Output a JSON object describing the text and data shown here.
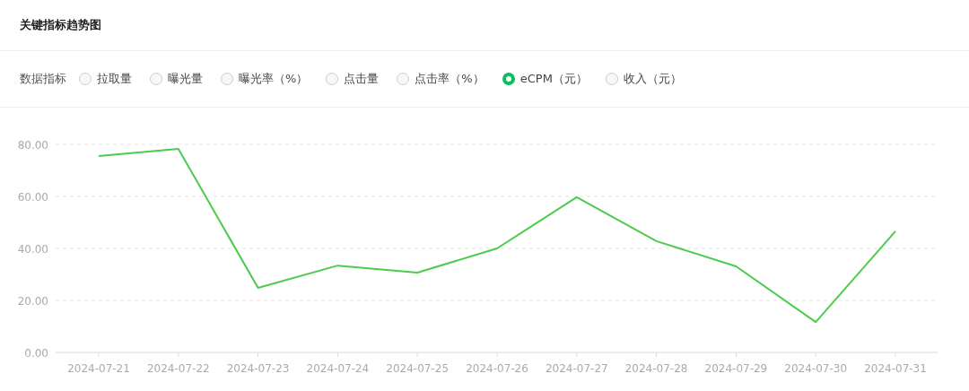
{
  "title": "关键指标趋势图",
  "metric_selector": {
    "label": "数据指标",
    "options": [
      {
        "label": "拉取量",
        "selected": false
      },
      {
        "label": "曝光量",
        "selected": false
      },
      {
        "label": "曝光率（%）",
        "selected": false
      },
      {
        "label": "点击量",
        "selected": false
      },
      {
        "label": "点击率（%）",
        "selected": false
      },
      {
        "label": "eCPM（元）",
        "selected": true
      },
      {
        "label": "收入（元）",
        "selected": false
      }
    ]
  },
  "chart_data": {
    "type": "line",
    "categories": [
      "2024-07-21",
      "2024-07-22",
      "2024-07-23",
      "2024-07-24",
      "2024-07-25",
      "2024-07-26",
      "2024-07-27",
      "2024-07-28",
      "2024-07-29",
      "2024-07-30",
      "2024-07-31"
    ],
    "ylim": [
      0,
      80
    ],
    "yticks": [
      {
        "value": 0,
        "label": "0.00"
      },
      {
        "value": 20,
        "label": "20.00"
      },
      {
        "value": 40,
        "label": "40.00"
      },
      {
        "value": 60,
        "label": "60.00"
      },
      {
        "value": 80,
        "label": "80.00"
      }
    ],
    "grid": true,
    "series": [
      {
        "color": "#4ccb4c",
        "values": [
          75.5,
          78.3,
          24.8,
          33.4,
          30.7,
          40.0,
          59.7,
          42.8,
          33.1,
          11.7,
          46.6
        ]
      }
    ]
  }
}
